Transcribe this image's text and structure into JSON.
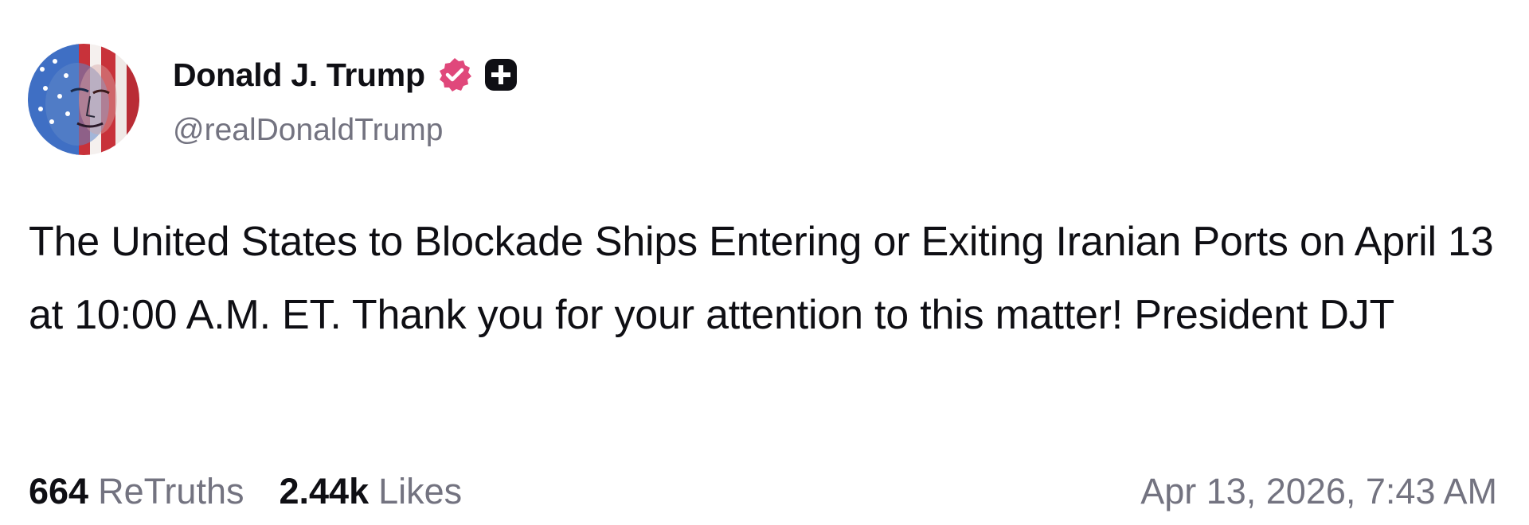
{
  "author": {
    "display_name": "Donald J. Trump",
    "handle": "@realDonaldTrump",
    "avatar_icon": "avatar-flag-portrait",
    "verified_icon": "verified-badge-icon",
    "verified_color": "#e0487b",
    "plus_badge_icon": "plus-badge-icon"
  },
  "post": {
    "text": "The United States to Blockade Ships Entering or Exiting Iranian Ports on April 13 at 10:00 A.M. ET. Thank you for your attention to this matter! President DJT"
  },
  "stats": {
    "retruths_count": "664",
    "retruths_label": "ReTruths",
    "likes_count": "2.44k",
    "likes_label": "Likes"
  },
  "timestamp": "Apr 13, 2026, 7:43 AM"
}
